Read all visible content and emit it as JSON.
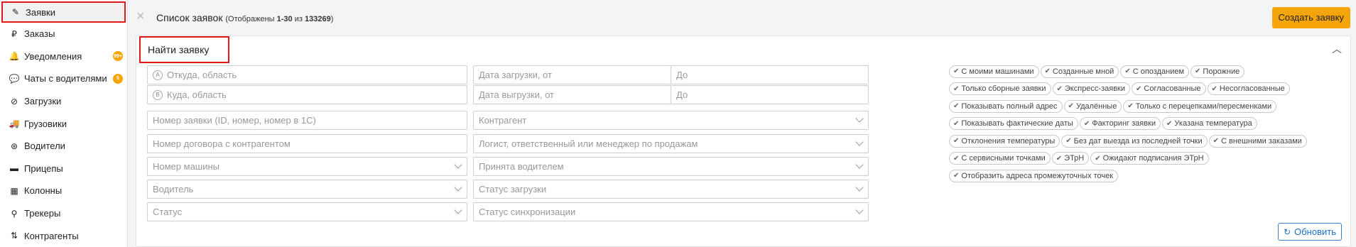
{
  "sidebar": {
    "items": [
      {
        "label": "Заявки",
        "icon": "edit-icon",
        "glyph": "✎"
      },
      {
        "label": "Заказы",
        "icon": "ruble-icon",
        "glyph": "₽"
      },
      {
        "label": "Уведомления",
        "icon": "bell-icon",
        "glyph": "🔔",
        "badge": "99+"
      },
      {
        "label": "Чаты с водителями",
        "icon": "chat-icon",
        "glyph": "💬",
        "badge": "5"
      },
      {
        "label": "Загрузки",
        "icon": "compass-icon",
        "glyph": "⊘"
      },
      {
        "label": "Грузовики",
        "icon": "truck-icon",
        "glyph": "🚚"
      },
      {
        "label": "Водители",
        "icon": "steering-wheel-icon",
        "glyph": "⊛"
      },
      {
        "label": "Прицепы",
        "icon": "trailer-icon",
        "glyph": "▬"
      },
      {
        "label": "Колонны",
        "icon": "warehouse-icon",
        "glyph": "▦"
      },
      {
        "label": "Трекеры",
        "icon": "map-pin-icon",
        "glyph": "⚲"
      },
      {
        "label": "Контрагенты",
        "icon": "sort-icon",
        "glyph": "⇅"
      }
    ]
  },
  "header": {
    "title": "Список заявок",
    "shown_prefix": "(Отображены ",
    "shown_range": "1-30",
    "shown_of": " из ",
    "shown_total": "133269",
    "shown_suffix": ")",
    "create_label": "Создать заявку"
  },
  "search": {
    "title": "Найти заявку",
    "from_placeholder": "Откуда, область",
    "from_marker": "A",
    "to_placeholder": "Куда, область",
    "to_marker": "B",
    "load_date_from": "Дата загрузки, от",
    "load_date_to": "До",
    "unload_date_from": "Дата выгрузки, от",
    "unload_date_to": "До",
    "order_number": "Номер заявки (ID, номер, номер в 1С)",
    "counterparty": "Контрагент",
    "contract_number": "Номер договора с контрагентом",
    "logist": "Логист, ответственный или менеджер по продажам",
    "vehicle_number": "Номер машины",
    "accepted_by_driver": "Принята водителем",
    "driver": "Водитель",
    "load_status": "Статус загрузки",
    "status": "Статус",
    "sync_status": "Статус синхронизации",
    "refresh_label": "Обновить"
  },
  "filters": [
    "С моими машинами",
    "Созданные мной",
    "С опозданием",
    "Порожние",
    "Только сборные заявки",
    "Экспресс-заявки",
    "Согласованные",
    "Несогласованные",
    "Показывать полный адрес",
    "Удалённые",
    "Только с перецепками/пересменками",
    "Показывать фактические даты",
    "Факторинг заявки",
    "Указана температура",
    "Отклонения температуры",
    "Без дат выезда из последней точки",
    "С внешними заказами",
    "С сервисными точками",
    "ЭТрН",
    "Ожидают подписания ЭТрН",
    "Отобразить адреса промежуточных точек"
  ],
  "colors": {
    "accent": "#f5a50a",
    "highlight": "#e01919",
    "link": "#1f6fc9"
  }
}
